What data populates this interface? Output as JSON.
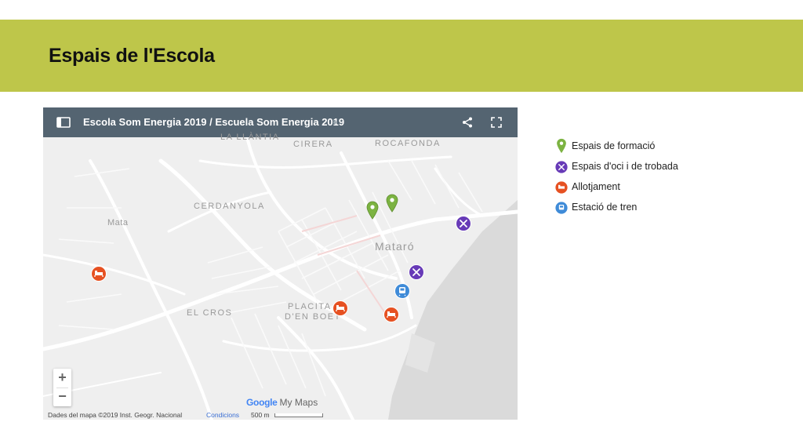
{
  "page": {
    "title": "Espais de l'Escola"
  },
  "map": {
    "title": "Escola Som Energia 2019 / Escuela Som Energia 2019",
    "icons": {
      "sidebar": "sidebar-toggle-icon",
      "share": "share-icon",
      "fullscreen": "fullscreen-icon"
    },
    "labels": {
      "la_llantia": "LA LLÀNTIA",
      "cirera": "CIRERA",
      "rocafonda": "ROCAFONDA",
      "cerdanyola": "CERDANYOLA",
      "mata": "Mata",
      "mataro": "Mataró",
      "el_cros": "EL CROS",
      "placita_1": "PLACITA",
      "placita_2": "D'EN BOET"
    },
    "zoom_in": "+",
    "zoom_out": "−",
    "brand_google": "Google",
    "brand_mymaps": "My Maps",
    "credit": "Dades del mapa ©2019 Inst. Geogr. Nacional",
    "conditions": "Condicions",
    "scale": "500 m"
  },
  "legend": [
    {
      "label": "Espais de formació",
      "icon": "green-pin-icon",
      "color": "#7cb342"
    },
    {
      "label": "Espais d'oci i de trobada",
      "icon": "fork-knife-icon",
      "color": "#673ab7"
    },
    {
      "label": "Allotjament",
      "icon": "bed-icon",
      "color": "#e65122"
    },
    {
      "label": "Estació de tren",
      "icon": "train-icon",
      "color": "#3f8bd8"
    }
  ],
  "colors": {
    "banner": "#bec64a",
    "mapbar": "#546471"
  }
}
